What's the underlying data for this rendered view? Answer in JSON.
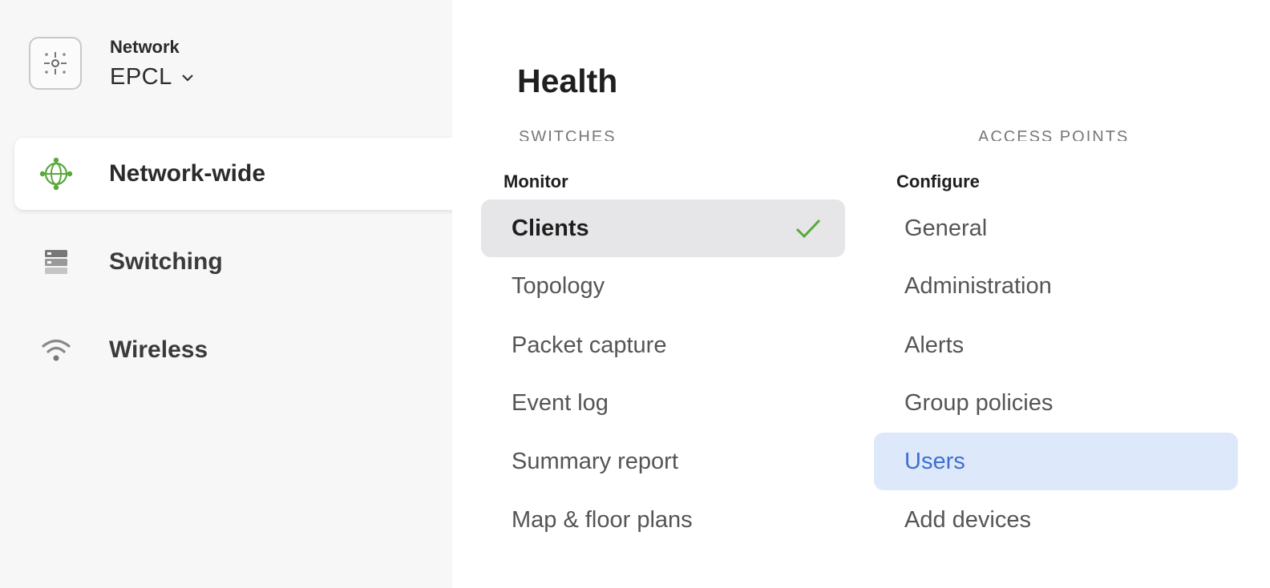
{
  "network": {
    "label": "Network",
    "name": "EPCL"
  },
  "sidebar": {
    "items": [
      {
        "label": "Network-wide",
        "icon": "globe-icon",
        "active": true
      },
      {
        "label": "Switching",
        "icon": "server-stack-icon",
        "active": false
      },
      {
        "label": "Wireless",
        "icon": "wifi-icon",
        "active": false
      }
    ]
  },
  "main": {
    "title": "Health",
    "section_left": "SWITCHES",
    "section_right": "ACCESS POINTS"
  },
  "menu": {
    "monitor": {
      "heading": "Monitor",
      "items": [
        "Clients",
        "Topology",
        "Packet capture",
        "Event log",
        "Summary report",
        "Map & floor plans"
      ],
      "selected": "Clients"
    },
    "configure": {
      "heading": "Configure",
      "items": [
        "General",
        "Administration",
        "Alerts",
        "Group policies",
        "Users",
        "Add devices"
      ],
      "highlighted": "Users"
    }
  },
  "colors": {
    "accent_green": "#5aa83c",
    "highlight_bg": "#dde9fb",
    "highlight_text": "#3d6fd1",
    "selected_bg": "#e6e6e8"
  }
}
